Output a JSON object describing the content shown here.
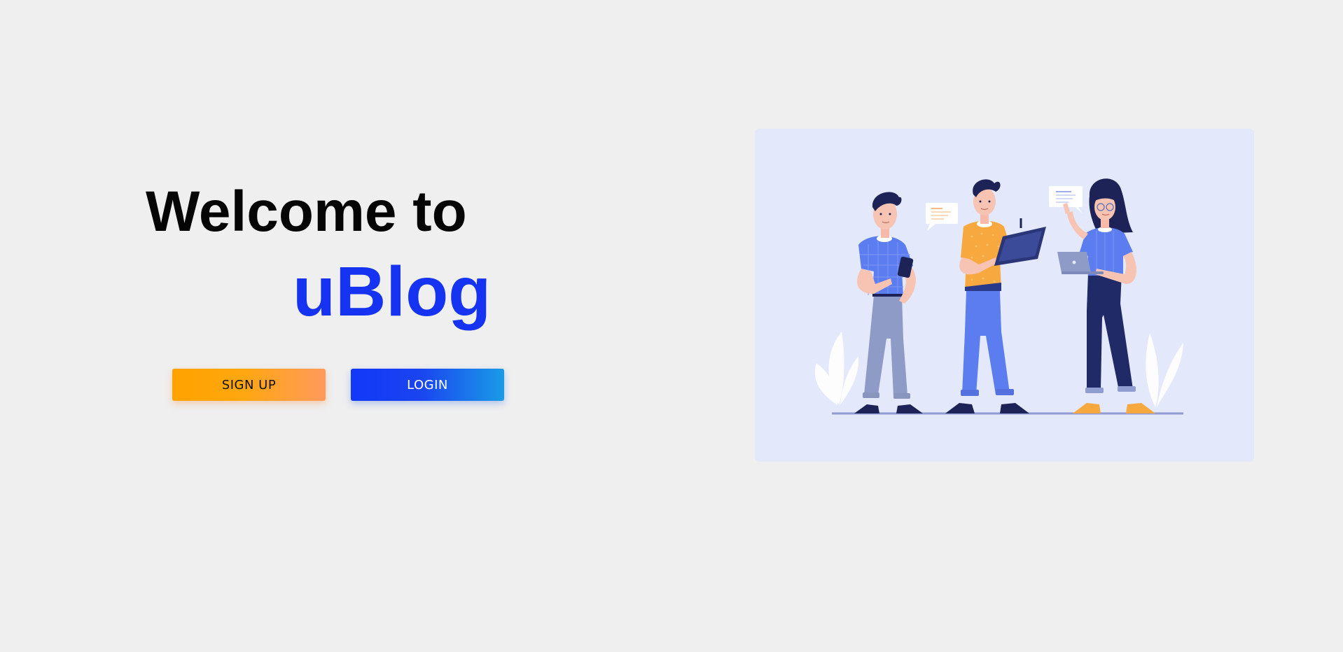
{
  "hero": {
    "welcome_text": "Welcome to",
    "brand_name": "uBlog"
  },
  "actions": {
    "signup_label": "SIGN UP",
    "login_label": "LOGIN"
  },
  "colors": {
    "background": "#efefef",
    "brand_blue": "#1533f0",
    "signup_orange": "#ffa200",
    "login_blue": "#1238f8",
    "illustration_bg": "#e3e8fb"
  },
  "illustration": {
    "icon": "team-collaboration-illustration"
  }
}
